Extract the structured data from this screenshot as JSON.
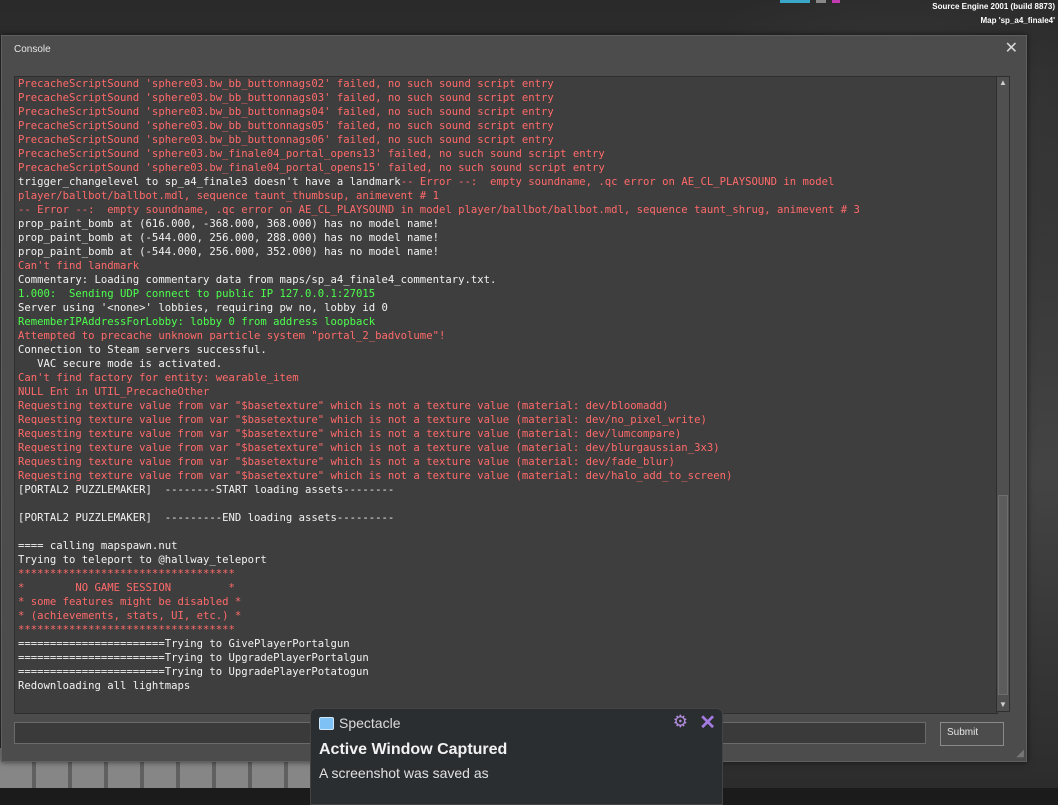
{
  "hud": {
    "engine": "Source Engine 2001 (build 8873)",
    "map": "Map 'sp_a4_finale4'"
  },
  "console": {
    "title": "Console",
    "close_icon": "close-icon",
    "submit_label": "Submit",
    "input_value": "",
    "lines": [
      {
        "type": "error",
        "text": "PrecacheScriptSound 'sphere03.bw_bb_buttonnags02' failed, no such sound script entry"
      },
      {
        "type": "error",
        "text": "PrecacheScriptSound 'sphere03.bw_bb_buttonnags03' failed, no such sound script entry"
      },
      {
        "type": "error",
        "text": "PrecacheScriptSound 'sphere03.bw_bb_buttonnags04' failed, no such sound script entry"
      },
      {
        "type": "error",
        "text": "PrecacheScriptSound 'sphere03.bw_bb_buttonnags05' failed, no such sound script entry"
      },
      {
        "type": "error",
        "text": "PrecacheScriptSound 'sphere03.bw_bb_buttonnags06' failed, no such sound script entry"
      },
      {
        "type": "error",
        "text": "PrecacheScriptSound 'sphere03.bw_finale04_portal_opens13' failed, no such sound script entry"
      },
      {
        "type": "error",
        "text": "PrecacheScriptSound 'sphere03.bw_finale04_portal_opens15' failed, no such sound script entry"
      },
      {
        "type": "mixed",
        "text": "trigger_changelevel to sp_a4_finale3 doesn't have a landmark",
        "text2": "-- Error --:  empty soundname, .qc error on AE_CL_PLAYSOUND in model"
      },
      {
        "type": "error",
        "text": "player/ballbot/ballbot.mdl, sequence taunt_thumbsup, animevent # 1"
      },
      {
        "type": "error",
        "text": "-- Error --:  empty soundname, .qc error on AE_CL_PLAYSOUND in model player/ballbot/ballbot.mdl, sequence taunt_shrug, animevent # 3"
      },
      {
        "type": "normal",
        "text": "prop_paint_bomb at (616.000, -368.000, 368.000) has no model name!"
      },
      {
        "type": "normal",
        "text": "prop_paint_bomb at (-544.000, 256.000, 288.000) has no model name!"
      },
      {
        "type": "normal",
        "text": "prop_paint_bomb at (-544.000, 256.000, 352.000) has no model name!"
      },
      {
        "type": "error",
        "text": "Can't find landmark"
      },
      {
        "type": "normal",
        "text": "Commentary: Loading commentary data from maps/sp_a4_finale4_commentary.txt."
      },
      {
        "type": "success",
        "text": "1.000:  Sending UDP connect to public IP 127.0.0.1:27015"
      },
      {
        "type": "normal",
        "text": "Server using '<none>' lobbies, requiring pw no, lobby id 0"
      },
      {
        "type": "success",
        "text": "RememberIPAddressForLobby: lobby 0 from address loopback"
      },
      {
        "type": "error",
        "text": "Attempted to precache unknown particle system \"portal_2_badvolume\"!"
      },
      {
        "type": "normal",
        "text": "Connection to Steam servers successful."
      },
      {
        "type": "normal",
        "text": "   VAC secure mode is activated."
      },
      {
        "type": "error",
        "text": "Can't find factory for entity: wearable_item"
      },
      {
        "type": "error",
        "text": "NULL Ent in UTIL_PrecacheOther"
      },
      {
        "type": "error",
        "text": "Requesting texture value from var \"$basetexture\" which is not a texture value (material: dev/bloomadd)"
      },
      {
        "type": "error",
        "text": "Requesting texture value from var \"$basetexture\" which is not a texture value (material: dev/no_pixel_write)"
      },
      {
        "type": "error",
        "text": "Requesting texture value from var \"$basetexture\" which is not a texture value (material: dev/lumcompare)"
      },
      {
        "type": "error",
        "text": "Requesting texture value from var \"$basetexture\" which is not a texture value (material: dev/blurgaussian_3x3)"
      },
      {
        "type": "error",
        "text": "Requesting texture value from var \"$basetexture\" which is not a texture value (material: dev/fade_blur)"
      },
      {
        "type": "error",
        "text": "Requesting texture value from var \"$basetexture\" which is not a texture value (material: dev/halo_add_to_screen)"
      },
      {
        "type": "normal",
        "text": "[PORTAL2 PUZZLEMAKER]  --------START loading assets--------"
      },
      {
        "type": "blank",
        "text": ""
      },
      {
        "type": "normal",
        "text": "[PORTAL2 PUZZLEMAKER]  ---------END loading assets---------"
      },
      {
        "type": "blank",
        "text": ""
      },
      {
        "type": "normal",
        "text": "==== calling mapspawn.nut"
      },
      {
        "type": "normal",
        "text": "Trying to teleport to @hallway_teleport"
      },
      {
        "type": "error",
        "text": "**********************************"
      },
      {
        "type": "error",
        "text": "*        NO GAME SESSION         *"
      },
      {
        "type": "error",
        "text": "* some features might be disabled *"
      },
      {
        "type": "error",
        "text": "* (achievements, stats, UI, etc.) *"
      },
      {
        "type": "error",
        "text": "**********************************"
      },
      {
        "type": "normal",
        "text": "=======================Trying to GivePlayerPortalgun"
      },
      {
        "type": "normal",
        "text": "=======================Trying to UpgradePlayerPortalgun"
      },
      {
        "type": "normal",
        "text": "=======================Trying to UpgradePlayerPotatogun"
      },
      {
        "type": "normal",
        "text": "Redownloading all lightmaps"
      }
    ]
  },
  "notification": {
    "app_name": "Spectacle",
    "title": "Active Window Captured",
    "body": "A screenshot was saved as",
    "settings_icon": "gear-icon",
    "close_icon": "close-icon"
  },
  "colors": {
    "normal_text": "#f2f2f2",
    "error_text": "#ff6a6a",
    "success_text": "#4dff4d",
    "console_bg": "#4c4c4c",
    "output_bg": "#3e3e3e"
  }
}
